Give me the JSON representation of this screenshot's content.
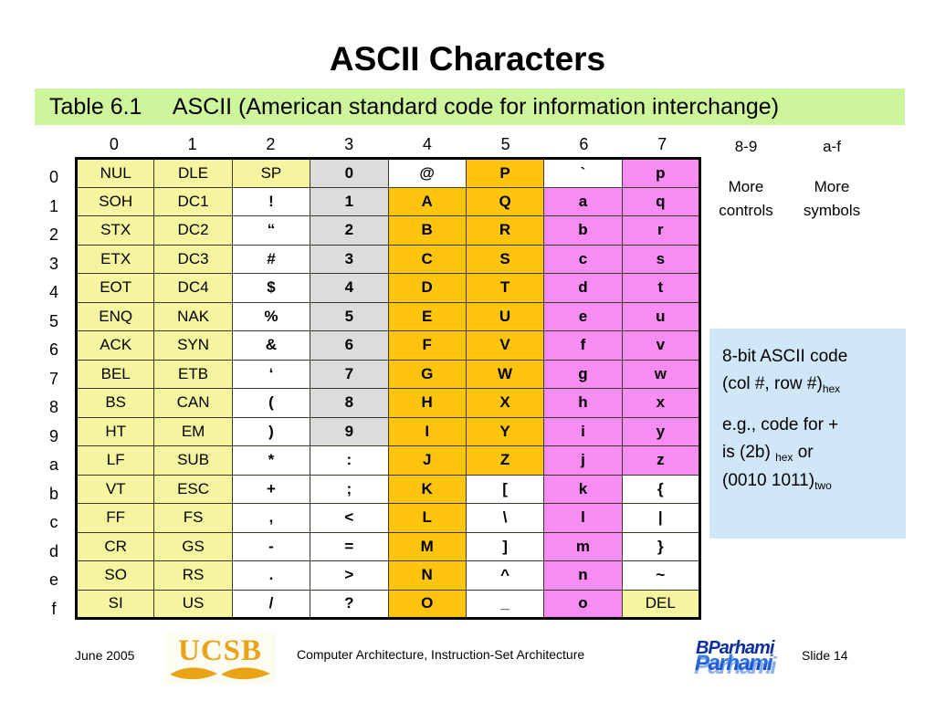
{
  "slide": {
    "title": "ASCII Characters",
    "caption": "Table 6.1     ASCII (American standard code for information interchange)"
  },
  "table": {
    "col_headers": [
      "0",
      "1",
      "2",
      "3",
      "4",
      "5",
      "6",
      "7"
    ],
    "row_headers": [
      "0",
      "1",
      "2",
      "3",
      "4",
      "5",
      "6",
      "7",
      "8",
      "9",
      "a",
      "b",
      "c",
      "d",
      "e",
      "f"
    ],
    "rows": [
      [
        {
          "text": "NUL",
          "style": "ctrl"
        },
        {
          "text": "DLE",
          "style": "ctrl"
        },
        {
          "text": "SP",
          "style": "ctrl"
        },
        {
          "text": "0",
          "style": "digit"
        },
        {
          "text": "@",
          "style": "plain"
        },
        {
          "text": "P",
          "style": "upper"
        },
        {
          "text": "`",
          "style": "plain"
        },
        {
          "text": "p",
          "style": "lower"
        }
      ],
      [
        {
          "text": "SOH",
          "style": "ctrl"
        },
        {
          "text": "DC1",
          "style": "ctrl"
        },
        {
          "text": "!",
          "style": "plain"
        },
        {
          "text": "1",
          "style": "digit"
        },
        {
          "text": "A",
          "style": "upper"
        },
        {
          "text": "Q",
          "style": "upper"
        },
        {
          "text": "a",
          "style": "lower"
        },
        {
          "text": "q",
          "style": "lower"
        }
      ],
      [
        {
          "text": "STX",
          "style": "ctrl"
        },
        {
          "text": "DC2",
          "style": "ctrl"
        },
        {
          "text": "“",
          "style": "plain"
        },
        {
          "text": "2",
          "style": "digit"
        },
        {
          "text": "B",
          "style": "upper"
        },
        {
          "text": "R",
          "style": "upper"
        },
        {
          "text": "b",
          "style": "lower"
        },
        {
          "text": "r",
          "style": "lower"
        }
      ],
      [
        {
          "text": "ETX",
          "style": "ctrl"
        },
        {
          "text": "DC3",
          "style": "ctrl"
        },
        {
          "text": "#",
          "style": "plain"
        },
        {
          "text": "3",
          "style": "digit"
        },
        {
          "text": "C",
          "style": "upper"
        },
        {
          "text": "S",
          "style": "upper"
        },
        {
          "text": "c",
          "style": "lower"
        },
        {
          "text": "s",
          "style": "lower"
        }
      ],
      [
        {
          "text": "EOT",
          "style": "ctrl"
        },
        {
          "text": "DC4",
          "style": "ctrl"
        },
        {
          "text": "$",
          "style": "plain"
        },
        {
          "text": "4",
          "style": "digit"
        },
        {
          "text": "D",
          "style": "upper"
        },
        {
          "text": "T",
          "style": "upper"
        },
        {
          "text": "d",
          "style": "lower"
        },
        {
          "text": "t",
          "style": "lower"
        }
      ],
      [
        {
          "text": "ENQ",
          "style": "ctrl"
        },
        {
          "text": "NAK",
          "style": "ctrl"
        },
        {
          "text": "%",
          "style": "plain"
        },
        {
          "text": "5",
          "style": "digit"
        },
        {
          "text": "E",
          "style": "upper"
        },
        {
          "text": "U",
          "style": "upper"
        },
        {
          "text": "e",
          "style": "lower"
        },
        {
          "text": "u",
          "style": "lower"
        }
      ],
      [
        {
          "text": "ACK",
          "style": "ctrl"
        },
        {
          "text": "SYN",
          "style": "ctrl"
        },
        {
          "text": "&",
          "style": "plain"
        },
        {
          "text": "6",
          "style": "digit"
        },
        {
          "text": "F",
          "style": "upper"
        },
        {
          "text": "V",
          "style": "upper"
        },
        {
          "text": "f",
          "style": "lower"
        },
        {
          "text": "v",
          "style": "lower"
        }
      ],
      [
        {
          "text": "BEL",
          "style": "ctrl"
        },
        {
          "text": "ETB",
          "style": "ctrl"
        },
        {
          "text": "‘",
          "style": "plain"
        },
        {
          "text": "7",
          "style": "digit"
        },
        {
          "text": "G",
          "style": "upper"
        },
        {
          "text": "W",
          "style": "upper"
        },
        {
          "text": "g",
          "style": "lower"
        },
        {
          "text": "w",
          "style": "lower"
        }
      ],
      [
        {
          "text": "BS",
          "style": "ctrl"
        },
        {
          "text": "CAN",
          "style": "ctrl"
        },
        {
          "text": "(",
          "style": "plain"
        },
        {
          "text": "8",
          "style": "digit"
        },
        {
          "text": "H",
          "style": "upper"
        },
        {
          "text": "X",
          "style": "upper"
        },
        {
          "text": "h",
          "style": "lower"
        },
        {
          "text": "x",
          "style": "lower"
        }
      ],
      [
        {
          "text": "HT",
          "style": "ctrl"
        },
        {
          "text": "EM",
          "style": "ctrl"
        },
        {
          "text": ")",
          "style": "plain"
        },
        {
          "text": "9",
          "style": "digit"
        },
        {
          "text": "I",
          "style": "upper"
        },
        {
          "text": "Y",
          "style": "upper"
        },
        {
          "text": "i",
          "style": "lower"
        },
        {
          "text": "y",
          "style": "lower"
        }
      ],
      [
        {
          "text": "LF",
          "style": "ctrl"
        },
        {
          "text": "SUB",
          "style": "ctrl"
        },
        {
          "text": "*",
          "style": "plain"
        },
        {
          "text": ":",
          "style": "plain"
        },
        {
          "text": "J",
          "style": "upper"
        },
        {
          "text": "Z",
          "style": "upper"
        },
        {
          "text": "j",
          "style": "lower"
        },
        {
          "text": "z",
          "style": "lower"
        }
      ],
      [
        {
          "text": "VT",
          "style": "ctrl"
        },
        {
          "text": "ESC",
          "style": "ctrl"
        },
        {
          "text": "+",
          "style": "plain"
        },
        {
          "text": ";",
          "style": "plain"
        },
        {
          "text": "K",
          "style": "upper"
        },
        {
          "text": "[",
          "style": "plain"
        },
        {
          "text": "k",
          "style": "lower"
        },
        {
          "text": "{",
          "style": "plain"
        }
      ],
      [
        {
          "text": "FF",
          "style": "ctrl"
        },
        {
          "text": "FS",
          "style": "ctrl"
        },
        {
          "text": ",",
          "style": "plain"
        },
        {
          "text": "<",
          "style": "plain"
        },
        {
          "text": "L",
          "style": "upper"
        },
        {
          "text": "\\",
          "style": "plain"
        },
        {
          "text": "l",
          "style": "lower"
        },
        {
          "text": "|",
          "style": "plain"
        }
      ],
      [
        {
          "text": "CR",
          "style": "ctrl"
        },
        {
          "text": "GS",
          "style": "ctrl"
        },
        {
          "text": "-",
          "style": "plain"
        },
        {
          "text": "=",
          "style": "plain"
        },
        {
          "text": "M",
          "style": "upper"
        },
        {
          "text": "]",
          "style": "plain"
        },
        {
          "text": "m",
          "style": "lower"
        },
        {
          "text": "}",
          "style": "plain"
        }
      ],
      [
        {
          "text": "SO",
          "style": "ctrl"
        },
        {
          "text": "RS",
          "style": "ctrl"
        },
        {
          "text": ".",
          "style": "plain"
        },
        {
          "text": ">",
          "style": "plain"
        },
        {
          "text": "N",
          "style": "upper"
        },
        {
          "text": "^",
          "style": "plain"
        },
        {
          "text": "n",
          "style": "lower"
        },
        {
          "text": "~",
          "style": "plain"
        }
      ],
      [
        {
          "text": "SI",
          "style": "ctrl"
        },
        {
          "text": "US",
          "style": "ctrl"
        },
        {
          "text": "/",
          "style": "plain"
        },
        {
          "text": "?",
          "style": "plain"
        },
        {
          "text": "O",
          "style": "upper"
        },
        {
          "text": "_",
          "style": "plain"
        },
        {
          "text": "o",
          "style": "lower"
        },
        {
          "text": "DEL",
          "style": "ctrl"
        }
      ]
    ]
  },
  "side_notes": [
    {
      "header": "8-9",
      "line1": "More",
      "line2": "controls"
    },
    {
      "header": "a-f",
      "line1": "More",
      "line2": "symbols"
    }
  ],
  "info_box": {
    "line1_a": "8-bit ASCII code",
    "line2_a": "(col #, row #)",
    "line2_sub": "hex",
    "line3_a": "e.g., code for +",
    "line4_a": "is (2b) ",
    "line4_sub": "hex",
    "line4_b": " or",
    "line5_a": "(0010 1011)",
    "line5_sub": "two"
  },
  "footer": {
    "date": "June 2005",
    "title": "Computer Architecture, Instruction-Set Architecture",
    "slide": "Slide 14",
    "ucsb_logo_text": "UCSB",
    "author_logo_text": "BParhami"
  },
  "colors": {
    "banner_green": "#cdf59b",
    "control_yellow": "#f5f5a0",
    "digit_gray": "#dcdcdc",
    "uppercase_orange": "#ffc40d",
    "lowercase_pink": "#f78cf2",
    "info_blue": "#cfe7f7",
    "ucsb_gold": "#e8a317",
    "author_blue": "#1a53d8"
  }
}
